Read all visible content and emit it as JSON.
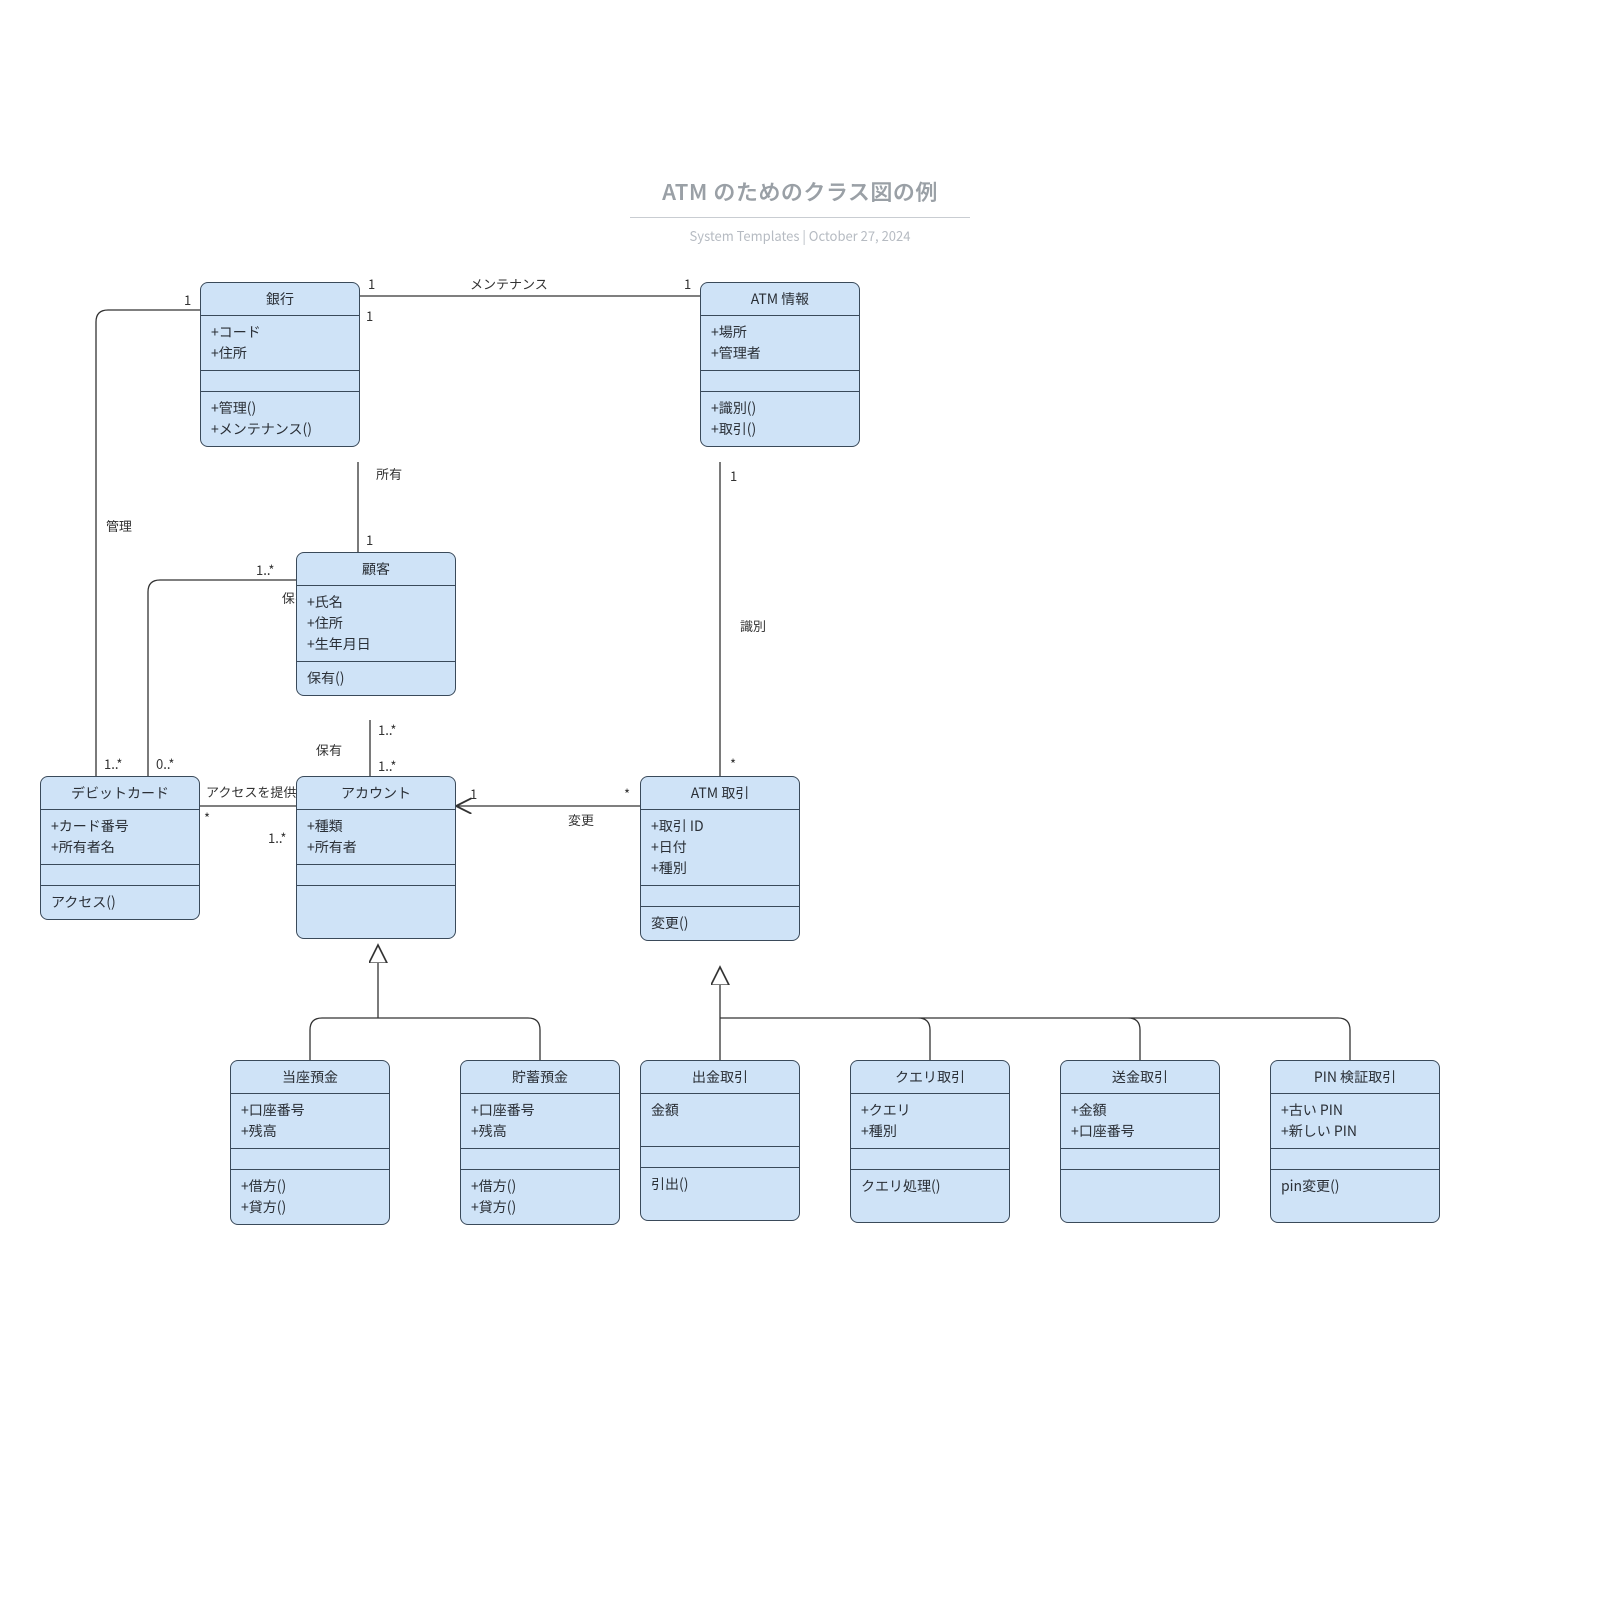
{
  "header": {
    "title": "ATM のためのクラス図の例",
    "subtitle": "System Templates  |  October 27, 2024"
  },
  "classes": {
    "bank": {
      "name": "銀行",
      "attrs": [
        "+コード",
        "+住所"
      ],
      "ops": [
        "+管理()",
        "+メンテナンス()"
      ]
    },
    "atmInfo": {
      "name": "ATM 情報",
      "attrs": [
        "+場所",
        "+管理者"
      ],
      "ops": [
        "+識別()",
        "+取引()"
      ]
    },
    "customer": {
      "name": "顧客",
      "attrs": [
        "+氏名",
        "+住所",
        "+生年月日"
      ],
      "ops": [
        "保有()"
      ]
    },
    "debit": {
      "name": "デビットカード",
      "attrs": [
        "+カード番号",
        "+所有者名"
      ],
      "ops": [
        "アクセス()"
      ]
    },
    "account": {
      "name": "アカウント",
      "attrs": [
        "+種類",
        "+所有者"
      ],
      "ops": []
    },
    "atmTxn": {
      "name": "ATM 取引",
      "attrs": [
        "+取引 ID",
        "+日付",
        "+種別"
      ],
      "ops": [
        "変更()"
      ]
    },
    "checking": {
      "name": "当座預金",
      "attrs": [
        "+口座番号",
        "+残高"
      ],
      "ops": [
        "+借方()",
        "+貸方()"
      ]
    },
    "savings": {
      "name": "貯蓄預金",
      "attrs": [
        "+口座番号",
        "+残高"
      ],
      "ops": [
        "+借方()",
        "+貸方()"
      ]
    },
    "withdraw": {
      "name": "出金取引",
      "attrs": [
        "金額"
      ],
      "ops": [
        "引出()"
      ]
    },
    "query": {
      "name": "クエリ取引",
      "attrs": [
        "+クエリ",
        "+種別"
      ],
      "ops": [
        "クエリ処理()"
      ]
    },
    "transfer": {
      "name": "送金取引",
      "attrs": [
        "+金額",
        "+口座番号"
      ],
      "ops": []
    },
    "pin": {
      "name": "PIN 検証取引",
      "attrs": [
        "+古い PIN",
        "+新しい PIN"
      ],
      "ops": [
        "pin変更()"
      ]
    }
  },
  "labels": {
    "maintenance": "メンテナンス",
    "own": "所有",
    "manage": "管理",
    "hold": "保有",
    "holdOp": "保有",
    "access": "アクセスを提供",
    "identify": "識別",
    "change": "変更",
    "m1": "1",
    "m1b": "1",
    "m1c": "1",
    "m1d": "1",
    "m1e": "1",
    "m1f": "1",
    "m1g": "1",
    "m1s": "1..*",
    "m1s2": "1..*",
    "m1s3": "1..*",
    "m1s4": "1..*",
    "m0s": "0..*",
    "mstar": "*",
    "mstar2": "*",
    "mstar3": "*"
  }
}
